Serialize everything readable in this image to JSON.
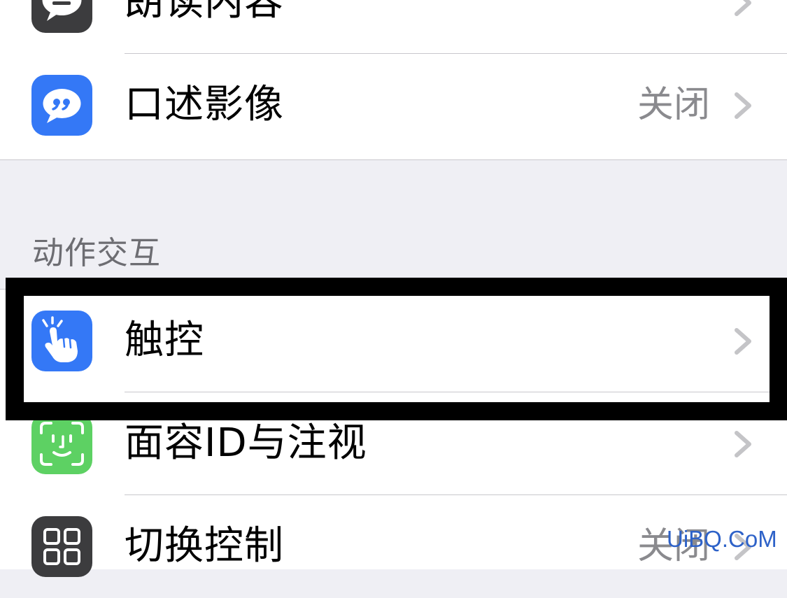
{
  "groups": {
    "top": {
      "rows": [
        {
          "label": "朗读内容",
          "value": "",
          "icon": "speech-bubble-icon"
        },
        {
          "label": "口述影像",
          "value": "关闭",
          "icon": "quote-bubble-icon"
        }
      ]
    },
    "motion": {
      "header": "动作交互",
      "rows": [
        {
          "label": "触控",
          "value": "",
          "icon": "hand-pointer-icon"
        },
        {
          "label": "面容ID与注视",
          "value": "",
          "icon": "face-id-icon"
        },
        {
          "label": "切换控制",
          "value": "关闭",
          "icon": "grid-icon"
        }
      ]
    }
  },
  "watermark": "UiBQ.CoM",
  "colors": {
    "page_background": "#efeff4",
    "row_background": "#ffffff",
    "separator": "#c8c7cc",
    "secondary_text": "#8a8a8e",
    "header_text": "#6d6d72",
    "chevron": "#c4c4c7",
    "highlight_box": "#000000",
    "icon_dark": "#3c3c3e",
    "icon_blue": "#3478f6",
    "icon_green": "#5dd163"
  }
}
